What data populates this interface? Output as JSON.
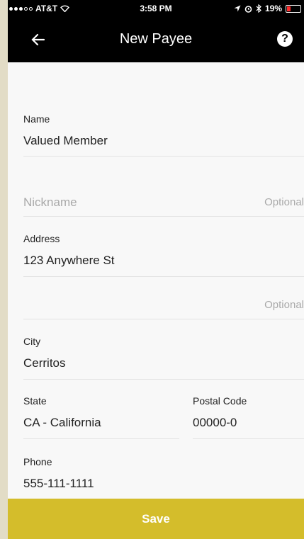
{
  "status_bar": {
    "carrier": "AT&T",
    "time": "3:58 PM",
    "battery_percent": "19%",
    "icons": [
      "signal-dots-icon",
      "wifi-icon",
      "location-icon",
      "alarm-icon",
      "bluetooth-icon",
      "battery-icon"
    ]
  },
  "nav": {
    "title": "New Payee",
    "back_icon": "back-arrow-icon",
    "help_icon": "help-icon",
    "help_glyph": "?"
  },
  "form": {
    "name": {
      "label": "Name",
      "value": "Valued Member"
    },
    "nickname": {
      "placeholder": "Nickname",
      "hint": "Optional"
    },
    "address": {
      "label": "Address",
      "value": "123 Anywhere St"
    },
    "address2": {
      "hint": "Optional"
    },
    "city": {
      "label": "City",
      "value": "Cerritos"
    },
    "state": {
      "label": "State",
      "value": "CA - California"
    },
    "postal_code": {
      "label": "Postal Code",
      "value": "00000-0"
    },
    "phone": {
      "label": "Phone",
      "value": "555-111-1111"
    }
  },
  "save_label": "Save",
  "colors": {
    "nav_bg": "#000000",
    "save_bg": "#d4bd2b",
    "battery_low": "#ff2a2a"
  }
}
